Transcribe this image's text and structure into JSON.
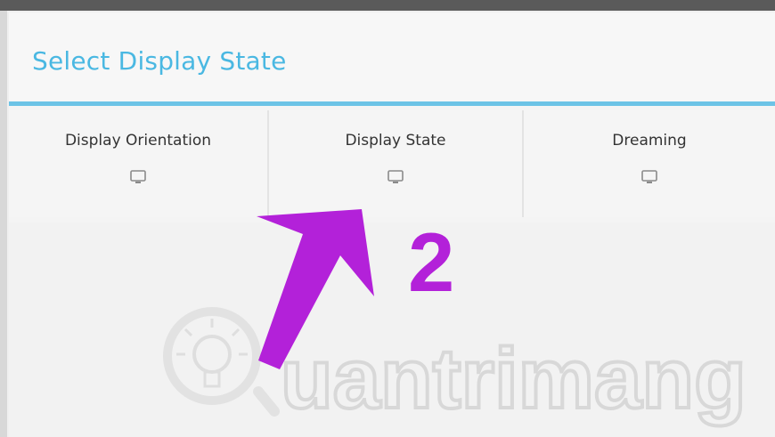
{
  "dialog": {
    "title": "Select Display State"
  },
  "options": [
    {
      "label": "Display Orientation",
      "icon": "monitor-icon"
    },
    {
      "label": "Display State",
      "icon": "monitor-icon"
    },
    {
      "label": "Dreaming",
      "icon": "monitor-icon"
    }
  ],
  "annotation": {
    "step_number": "2",
    "color": "#b321d9"
  },
  "watermark": {
    "text": "uantrimang",
    "icon": "lightbulb-icon"
  },
  "colors": {
    "title": "#4ab8e2",
    "accent_rule": "#6cc3e6"
  }
}
